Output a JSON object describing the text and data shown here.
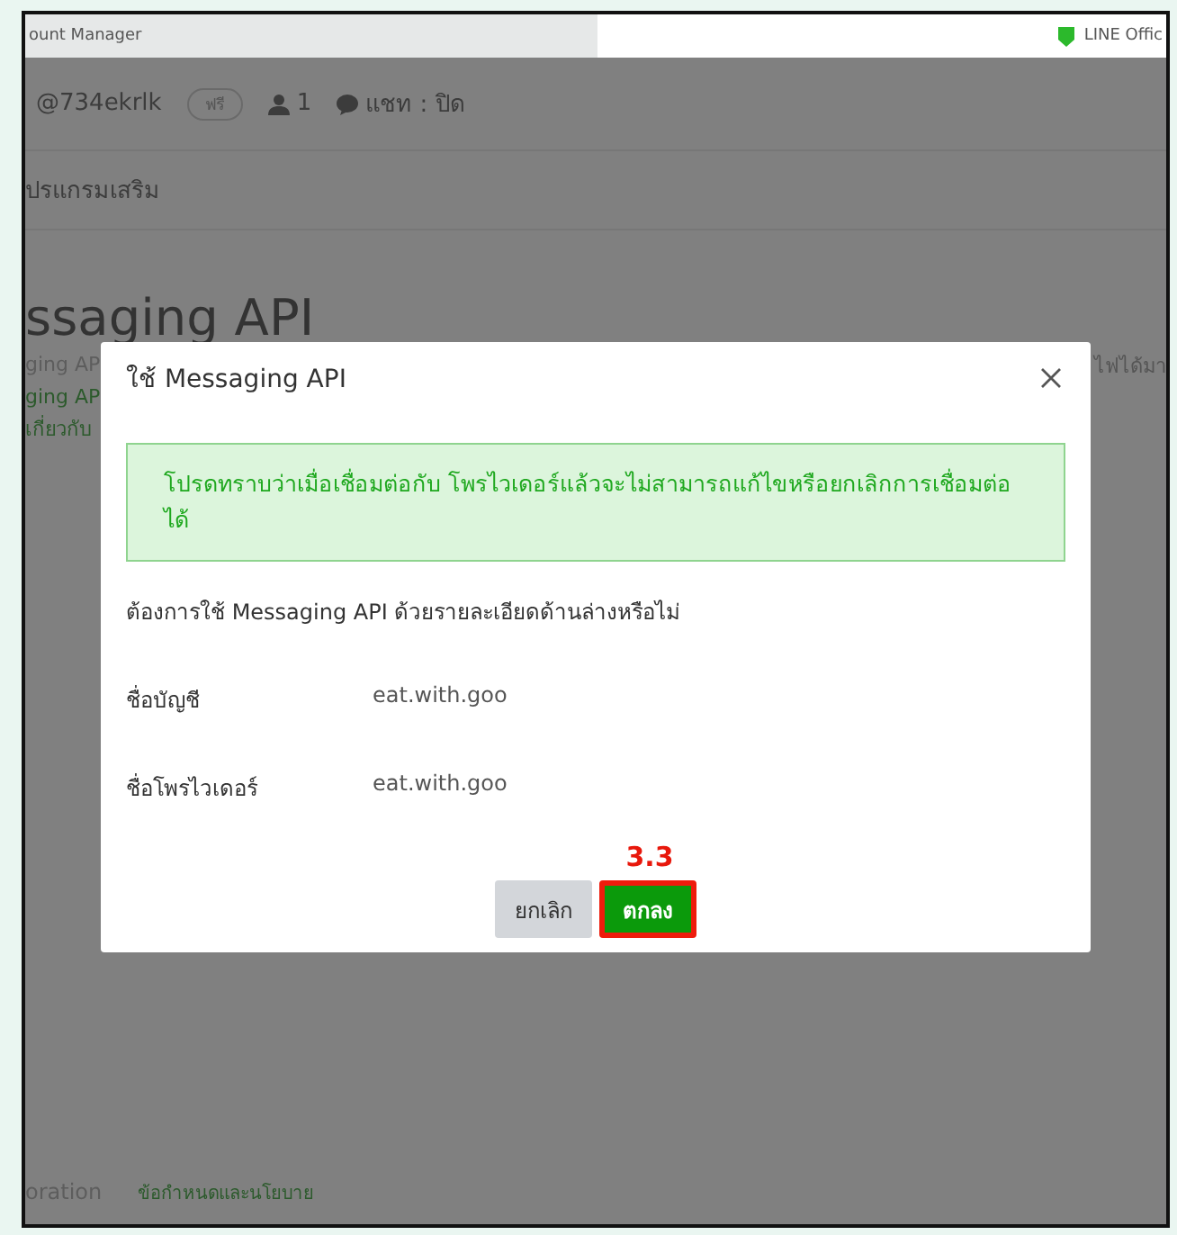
{
  "browser_tabs": [
    {
      "label": "ount Manager",
      "selected": false
    },
    {
      "label": "LINE Offic",
      "selected": true
    }
  ],
  "account": {
    "id": "@734ekrlk",
    "badge": "ฟรี",
    "friends": "1",
    "chat": "แชท : ปิด"
  },
  "section_title": "ปรแกรมเสริม",
  "page_title": "ssaging API",
  "left_fragments": [
    {
      "text": "ging AP",
      "kind": "muted"
    },
    {
      "text": "ging AP",
      "kind": "link"
    },
    {
      "text": "เกี่ยวกับ",
      "kind": "link"
    }
  ],
  "right_fragment": "ไฟได้มา",
  "footer": [
    {
      "text": "oration",
      "kind": "muted"
    },
    {
      "text": "ข้อกำหนดและนโยบาย",
      "kind": "link"
    }
  ],
  "dialog": {
    "title": "ใช้ Messaging API",
    "notice": "โปรดทราบว่าเมื่อเชื่อมต่อกับ โพรไวเดอร์แล้วจะไม่สามารถแก้ไขหรือยกเลิกการเชื่อมต่อได้",
    "question": "ต้องการใช้ Messaging API ด้วยรายละเอียดด้านล่างหรือไม่",
    "fields": [
      {
        "label": "ชื่อบัญชี",
        "value": "eat.with.goo"
      },
      {
        "label": "ชื่อโพรไวเดอร์",
        "value": "eat.with.goo"
      }
    ],
    "step_label": "3.3",
    "buttons": [
      {
        "label": "ยกเลิก",
        "kind": "secondary",
        "highlighted": false
      },
      {
        "label": "ตกลง",
        "kind": "primary",
        "highlighted": true
      }
    ]
  }
}
